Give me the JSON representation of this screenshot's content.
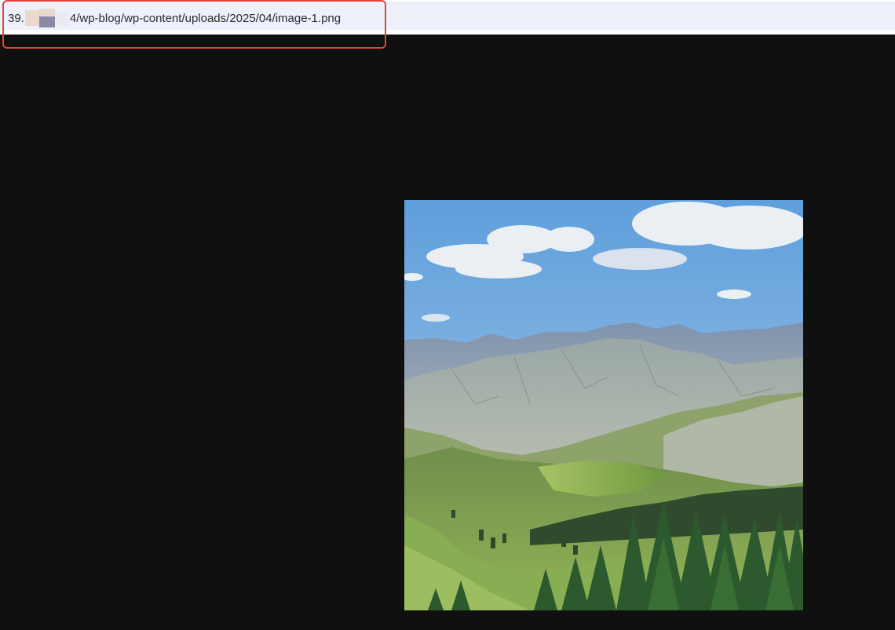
{
  "address_bar": {
    "url_prefix": "39.",
    "url_suffix": "4/wp-blog/wp-content/uploads/2025/04/image-1.png",
    "redacted": true
  },
  "annotation": {
    "color": "#e0473a"
  },
  "image": {
    "icon": "landscape-photo",
    "subject": "mountain valley with pine forest"
  },
  "colors": {
    "viewer_background": "#101010",
    "address_bar_background": "#eef1fa"
  }
}
